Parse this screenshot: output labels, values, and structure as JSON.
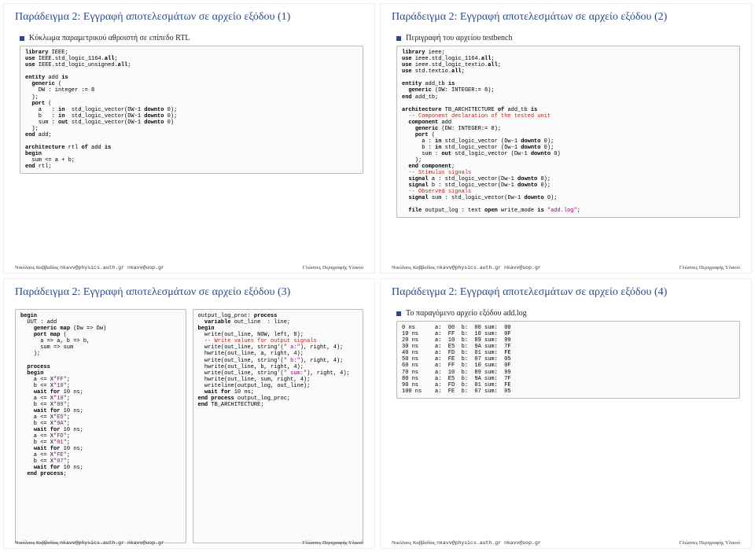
{
  "slides": {
    "s1": {
      "title": "Παράδειγμα 2: Εγγραφή αποτελεσμάτων σε αρχείο εξόδου (1)",
      "bullet": "Κύκλωμα παραμετρικού αθροιστή σε επίπεδο RTL"
    },
    "s2": {
      "title": "Παράδειγμα 2: Εγγραφή αποτελεσμάτων σε αρχείο εξόδου (2)",
      "bullet": "Περιγραφή του αρχείου testbench"
    },
    "s3": {
      "title": "Παράδειγμα 2: Εγγραφή αποτελεσμάτων σε αρχείο εξόδου (3)"
    },
    "s4": {
      "title": "Παράδειγμα 2: Εγγραφή αποτελεσμάτων σε αρχείο εξόδου (4)",
      "bullet": "Το παραγόμενο αρχείο εξόδου add.log"
    }
  },
  "footer": {
    "author": "Νικόλαος Καββαδίας",
    "email": "nkavv@physics.auth.gr nkavv@uop.gr",
    "right": "Γλώσσες Περιγραφής Υλικού"
  },
  "code": {
    "c1": "library IEEE;\nuse IEEE.std_logic_1164.all;\nuse IEEE.std_logic_unsigned.all;\n\nentity add is\n  generic (\n    DW : integer := 8\n  );\n  port (\n    a   : in  std_logic_vector(DW-1 downto 0);\n    b   : in  std_logic_vector(DW-1 downto 0);\n    sum : out std_logic_vector(DW-1 downto 0)\n  );\nend add;\n\narchitecture rtl of add is\nbegin\n  sum <= a + b;\nend rtl;",
    "c2": "library ieee;\nuse ieee.std_logic_1164.all;\nuse ieee.std_logic_textio.all;\nuse std.textio.all;\n\nentity add_tb is\n  generic (DW: INTEGER:= 8);\nend add_tb;\n\narchitecture TB_ARCHITECTURE of add_tb is\n  -- Component declaration of the tested unit\n  component add\n    generic (DW: INTEGER:= 8);\n    port (\n      a : in std_logic_vector (Dw-1 downto 0);\n      b : in std_logic_vector (Dw-1 downto 0);\n      sum : out std_logic_vector (Dw-1 downto 0)\n    );\n  end component;\n  -- Stimulus signals\n  signal a : std_logic_vector(Dw-1 downto 0);\n  signal b : std_logic_vector(Dw-1 downto 0);\n  -- Observed signals\n  signal sum : std_logic_vector(Dw-1 downto 0);\n\n  file output_log : text open write_mode is \"add.log\";",
    "c3a": "begin\n  UUT : add\n    generic map (Dw => Dw)\n    port map (\n      a => a, b => b,\n      sum => sum\n    );\n\n  process\n  begin\n    a <= X\"FF\";\n    b <= X\"10\";\n    wait for 10 ns;\n    a <= X\"10\";\n    b <= X\"89\";\n    wait for 10 ns;\n    a <= X\"E5\";\n    b <= X\"9A\";\n    wait for 10 ns;\n    a <= X\"FD\";\n    b <= X\"01\";\n    wait for 10 ns;\n    a <= X\"FE\";\n    b <= X\"07\";\n    wait for 10 ns;\n  end process;",
    "c3b": "output_log_proc: process\n  variable out_line  : line;\nbegin\n  write(out_line, NOW, left, 8);\n  -- Write values for output signals\n  write(out_line, string'(\" a:\"), right, 4);\n  hwrite(out_line, a, right, 4);\n  write(out_line, string'(\" b:\"), right, 4);\n  hwrite(out_line, b, right, 4);\n  write(out_line, string'(\" sum:\"), right, 4);\n  hwrite(out_line, sum, right, 4);\n  writeline(output_log, out_line);\n  wait for 10 ns;\nend process output_log_proc;\nend TB_ARCHITECTURE;",
    "c4": "0 ns      a:  00  b:  00 sum:  00\n10 ns     a:  FF  b:  10 sum:  0F\n20 ns     a:  10  b:  89 sum:  99\n30 ns     a:  E5  b:  9A sum:  7F\n40 ns     a:  FD  b:  01 sum:  FE\n50 ns     a:  FE  b:  07 sum:  05\n60 ns     a:  FF  b:  10 sum:  0F\n70 ns     a:  10  b:  89 sum:  99\n80 ns     a:  E5  b:  9A sum:  7F\n90 ns     a:  FD  b:  01 sum:  FE\n100 ns    a:  FE  b:  07 sum:  05"
  }
}
